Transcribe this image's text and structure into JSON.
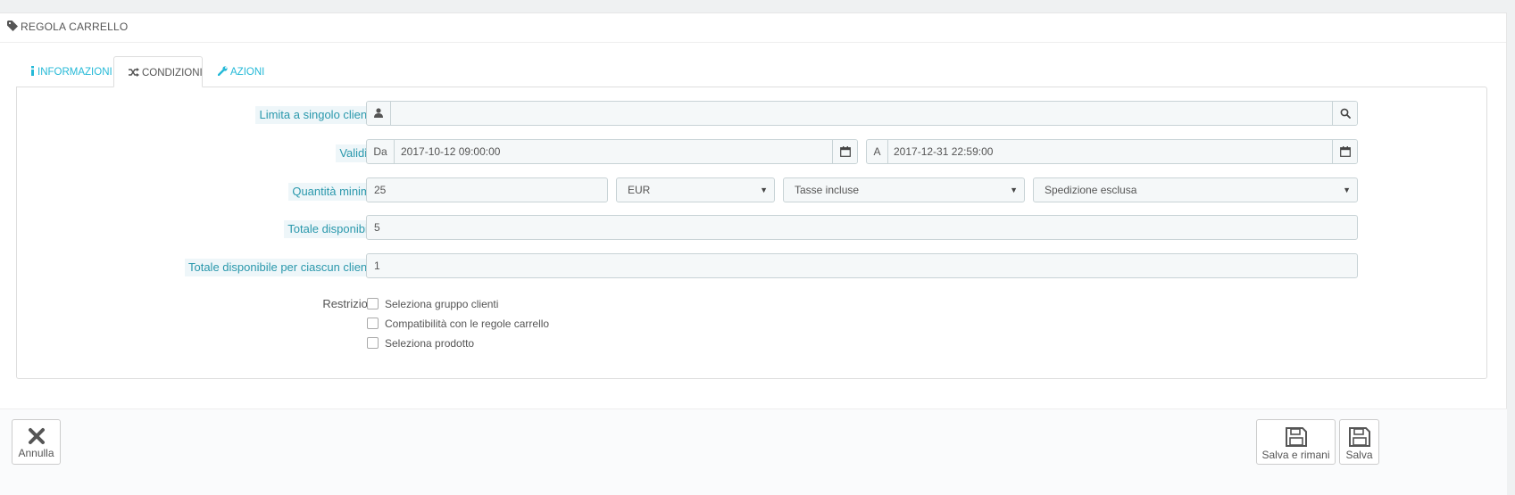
{
  "panel": {
    "title": "REGOLA CARRELLO"
  },
  "tabs": [
    {
      "label": "INFORMAZIONI",
      "icon": "info-icon",
      "active": false
    },
    {
      "label": "CONDIZIONI",
      "icon": "random-icon",
      "active": true
    },
    {
      "label": "AZIONI",
      "icon": "wrench-icon",
      "active": false
    }
  ],
  "form": {
    "customer": {
      "label": "Limita a singolo cliente",
      "value": ""
    },
    "validity": {
      "label": "Validità",
      "from_prefix": "Da",
      "from_value": "2017-10-12 09:00:00",
      "to_prefix": "A",
      "to_value": "2017-12-31 22:59:00"
    },
    "min_amount": {
      "label": "Quantità minima",
      "value": "25",
      "currency": "EUR",
      "tax": "Tasse incluse",
      "shipping": "Spedizione esclusa"
    },
    "total_available": {
      "label": "Totale disponibile",
      "value": "5"
    },
    "total_per_customer": {
      "label": "Totale disponibile per ciascun cliente",
      "value": "1"
    },
    "restrictions": {
      "label": "Restrizioni",
      "items": [
        {
          "label": "Seleziona gruppo clienti",
          "checked": false
        },
        {
          "label": "Compatibilità con le regole carrello",
          "checked": false
        },
        {
          "label": "Seleziona prodotto",
          "checked": false
        }
      ]
    }
  },
  "footer": {
    "cancel_label": "Annulla",
    "save_stay_label": "Salva e rimani",
    "save_label": "Salva"
  },
  "colors": {
    "accent": "#25b9d7",
    "label_bg": "#eef6f9",
    "field_bg": "#f5f8f9"
  }
}
